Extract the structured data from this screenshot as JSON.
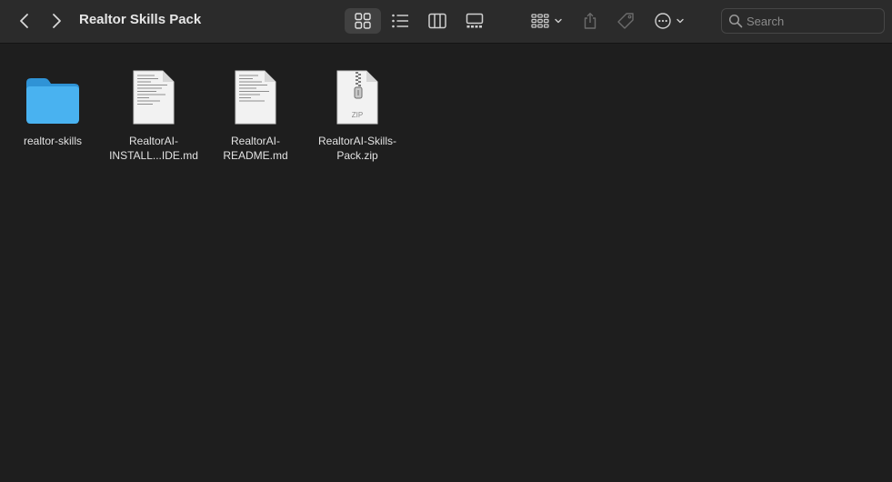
{
  "window": {
    "title": "Realtor Skills Pack"
  },
  "toolbar": {
    "back_icon": "chevron-left-icon",
    "forward_icon": "chevron-right-icon",
    "view_modes": [
      {
        "name": "icon-view",
        "icon": "grid-icon",
        "active": true
      },
      {
        "name": "list-view",
        "icon": "list-icon",
        "active": false
      },
      {
        "name": "column-view",
        "icon": "columns-icon",
        "active": false
      },
      {
        "name": "gallery-view",
        "icon": "gallery-icon",
        "active": false
      }
    ],
    "group_icon": "group-grid-icon",
    "share_icon": "share-icon",
    "tag_icon": "tag-icon",
    "more_icon": "ellipsis-circle-icon"
  },
  "search": {
    "placeholder": "Search",
    "value": ""
  },
  "files": [
    {
      "kind": "folder",
      "icon": "folder-icon",
      "label_lines": [
        "realtor-skills"
      ]
    },
    {
      "kind": "document",
      "icon": "markdown-document-icon",
      "label_lines": [
        "RealtorAI-",
        "INSTALL...IDE.md"
      ]
    },
    {
      "kind": "document",
      "icon": "markdown-document-icon",
      "label_lines": [
        "RealtorAI-",
        "README.md"
      ]
    },
    {
      "kind": "archive",
      "icon": "zip-archive-icon",
      "badge": "ZIP",
      "label_lines": [
        "RealtorAI-Skills-",
        "Pack.zip"
      ]
    }
  ],
  "colors": {
    "toolbar_bg": "#2b2b2b",
    "content_bg": "#1e1e1e",
    "folder_blue": "#3ba8ec",
    "text": "#e2e2e2"
  }
}
